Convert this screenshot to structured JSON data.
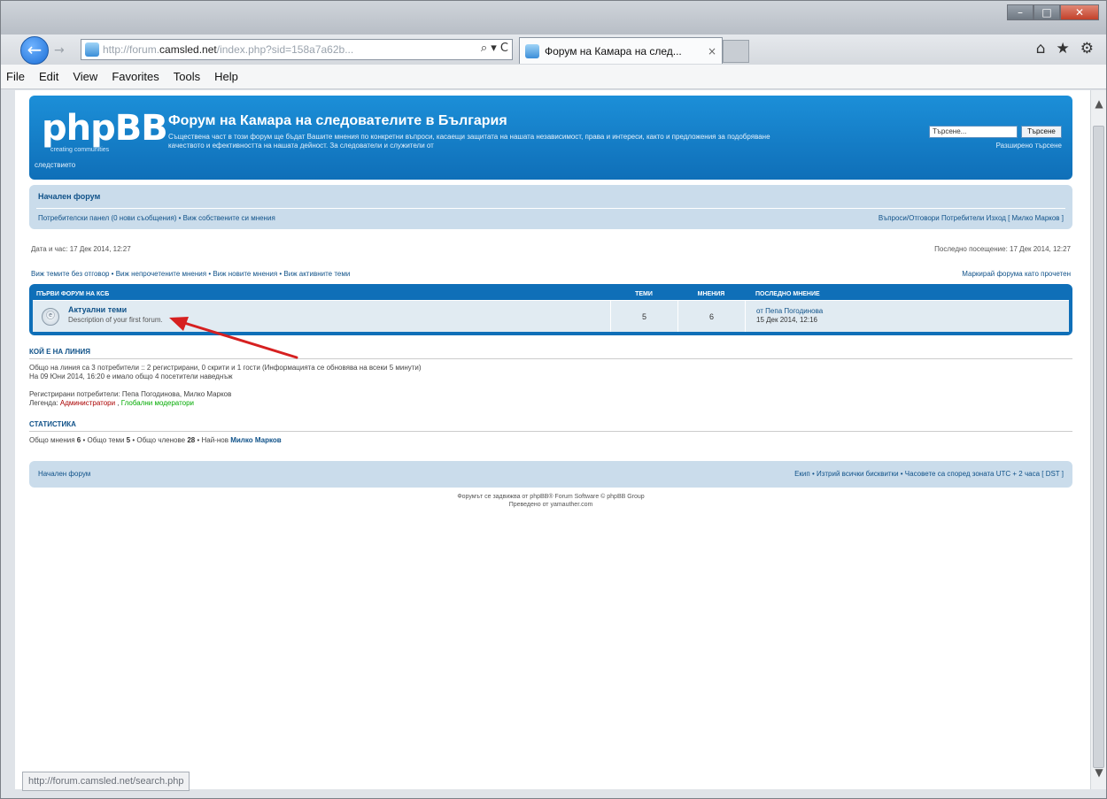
{
  "browser": {
    "address_url_prefix": "http://forum.",
    "address_url_domain": "camsled.net",
    "address_url_suffix": "/index.php?sid=158a7a62b...",
    "tab_title": "Форум на Камара на след...",
    "tab_close": "×",
    "back_glyph": "←",
    "forward_glyph": "→",
    "address_tools": "⌕ ▾ C",
    "right_icons": [
      "⌂",
      "★",
      "⚙"
    ],
    "window_controls": [
      "–",
      "□",
      "✕"
    ],
    "status_text": "http://forum.camsled.net/search.php"
  },
  "menubar": {
    "items": [
      "File",
      "Edit",
      "View",
      "Favorites",
      "Tools",
      "Help"
    ]
  },
  "header": {
    "logo": "phpBB",
    "logo_sub": "creating communities",
    "title": "Форум на Камара на следователите в България",
    "description": "Съществена част в този форум ще бъдат Вашите мнения по конкретни въпроси, касаещи защитата на нашата независимост, права и интереси, както и предложения за подобряване качеството и ефективността на нашата дейност. За следователи и служители от",
    "description_tail": "следствието",
    "search_placeholder": "Търсене...",
    "search_button": "Търсене",
    "advanced_search": "Разширено търсене"
  },
  "navbar": {
    "home": "Начален форум",
    "left_links": "Потребителски панел (0 нови съобщения) • Виж собствените си мнения",
    "right_links": "Въпроси/Отговори  Потребители  Изход [ Милко Марков ]"
  },
  "info": {
    "current_time": "Дата и час: 17 Дек 2014, 12:27",
    "last_visit": "Последно посещение: 17 Дек 2014, 12:27"
  },
  "links": {
    "left": "Виж темите без отговор • Виж непрочетените мнения • Виж новите мнения • Виж активните теми",
    "right": "Маркирай форума като прочетен"
  },
  "forumlist": {
    "headers": [
      "Първи форум на КСБ",
      "Теми",
      "Мнения",
      "Последно мнение"
    ],
    "rows": [
      {
        "name": "Актуални теми",
        "description": "Description of your first forum.",
        "topics": "5",
        "posts": "6",
        "last_post_by": "от Пепа Погодинова",
        "last_post_date": "15 Дек 2014, 12:16"
      }
    ]
  },
  "online": {
    "title": "Кой е на линия",
    "line1": "Общо на линия са 3 потребители :: 2 регистрирани, 0 скрити и 1 гости (Информацията се обновява на всеки 5 минути)",
    "line2": "На 09 Юни 2014, 16:20 е имало общо 4 посетители наведнъж",
    "registered_label": "Регистрирани потребители: Пепа Погодинова, Милко Марков",
    "legend_label": "Легенда: ",
    "legend_admin": "Администратори",
    "legend_sep": ", ",
    "legend_mod": "Глобални модератори"
  },
  "stats": {
    "title": "Статистика",
    "prefix1": "Общо мнения ",
    "posts": "6",
    "prefix2": " • Общо теми ",
    "topics": "5",
    "prefix3": " • Общо членове ",
    "members": "28",
    "prefix4": " • Най-нов ",
    "newest": "Милко Марков"
  },
  "footer": {
    "home": "Начален форум",
    "right": "Екип • Изтрий всички бисквитки • Часовете са според зоната UTC + 2 часа [ DST ]",
    "copyright1": "Форумът се задвижва от phpBB® Forum Software © phpBB Group",
    "copyright2": "Преведено от yamauther.com"
  },
  "colors": {
    "header_blue": "#0f6fb8",
    "nav_light": "#cadceb",
    "link": "#105289",
    "annotation_arrow": "#d62020"
  }
}
